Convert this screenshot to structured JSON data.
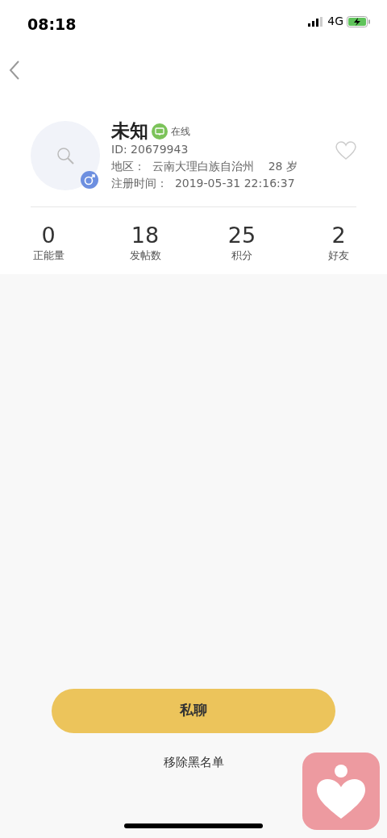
{
  "status_bar": {
    "time": "08:18",
    "network": "4G"
  },
  "profile": {
    "name": "未知",
    "online_status": "在线",
    "id": "ID: 20679943",
    "region": "地区：  云南大理白族自治州    28 岁",
    "registered": "注册时间：  2019-05-31 22:16:37",
    "favorited": false
  },
  "stats": [
    {
      "value": "0",
      "label": "正能量"
    },
    {
      "value": "18",
      "label": "发帖数"
    },
    {
      "value": "25",
      "label": "积分"
    },
    {
      "value": "2",
      "label": "好友"
    }
  ],
  "actions": {
    "primary": "私聊",
    "secondary": "移除黑名单"
  }
}
